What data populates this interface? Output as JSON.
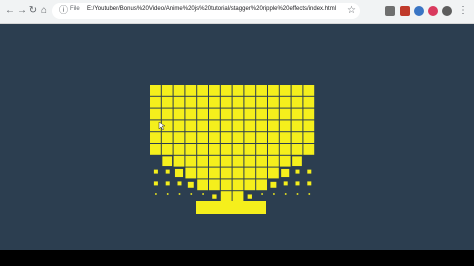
{
  "browser": {
    "back_icon": "arrow-left-icon",
    "forward_icon": "arrow-right-icon",
    "reload_icon": "reload-icon",
    "home_icon": "home-icon",
    "protocol_label": "File",
    "url": "E:/Youtuber/Bonus%20Video/Anime%20js%20tutorial/stagger%20ripple%20effects/index.html",
    "bookmark_icon": "star-icon"
  },
  "page": {
    "background_color": "#2c3e50",
    "tile_color": "#f5ef1c"
  }
}
